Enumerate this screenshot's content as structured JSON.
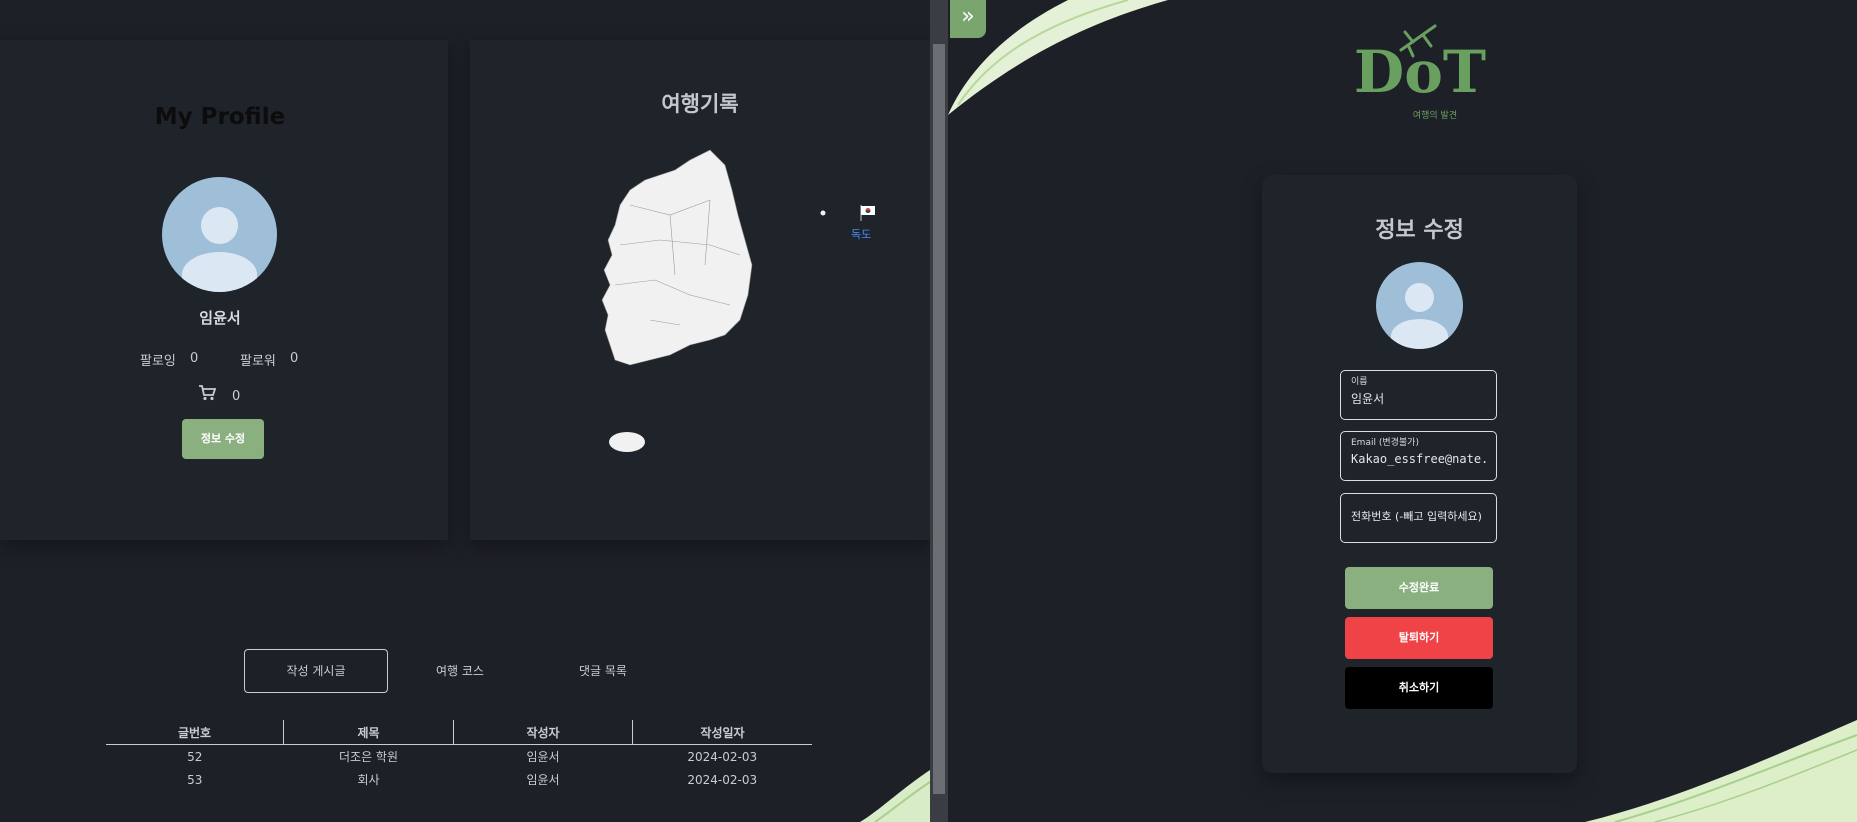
{
  "profile": {
    "title": "My Profile",
    "name": "임윤서",
    "following_label": "팔로잉",
    "following_count": "0",
    "followers_label": "팔로워",
    "followers_count": "0",
    "cart_count": "0",
    "edit_button": "정보 수정"
  },
  "map": {
    "title": "여행기록",
    "dokdo_label": "독도"
  },
  "tabs": [
    "작성 게시글",
    "여행 코스",
    "댓글 목록"
  ],
  "posts_table": {
    "headers": [
      "글번호",
      "제목",
      "작성자",
      "작성일자"
    ],
    "rows": [
      [
        "52",
        "더조은 학원",
        "임윤서",
        "2024-02-03"
      ],
      [
        "53",
        "회사",
        "임윤서",
        "2024-02-03"
      ]
    ]
  },
  "right_panel": {
    "collapse_icon": "double-chevron-right-icon",
    "logo_text": "DoT",
    "logo_subtitle": "여행의 발견",
    "form_title": "정보 수정",
    "name_label": "이름",
    "name_value": "임윤서",
    "email_label": "Email (변경불가)",
    "email_value": "Kakao_essfree@nate.com",
    "phone_placeholder": "전화번호 (-빼고 입력하세요)",
    "done_button": "수정완료",
    "withdraw_button": "탈퇴하기",
    "cancel_button": "취소하기"
  },
  "colors": {
    "accent_green": "#8bb07f",
    "danger_red": "#ef4348",
    "background": "#1d2027"
  }
}
